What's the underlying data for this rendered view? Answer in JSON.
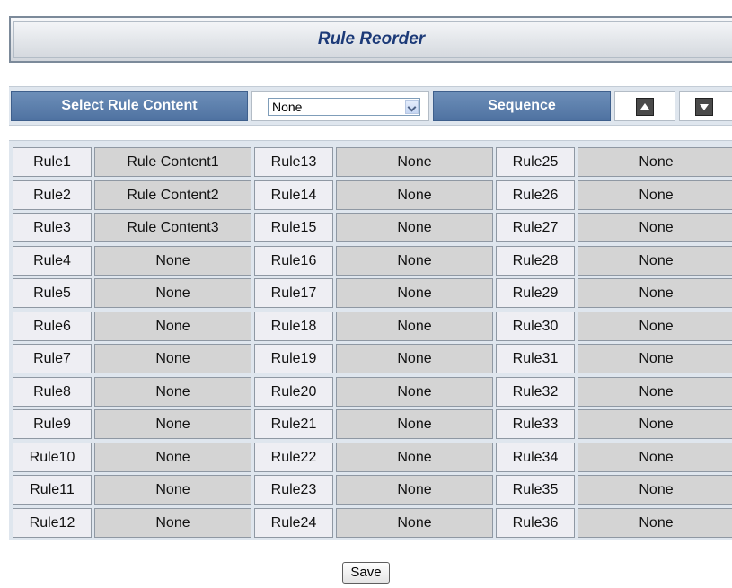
{
  "title": "Rule Reorder",
  "controls": {
    "select_label": "Select Rule Content",
    "selected_value": "None",
    "sequence_label": "Sequence",
    "up_icon": "arrow-up-icon",
    "down_icon": "arrow-down-icon"
  },
  "rules": {
    "columns": [
      [
        {
          "name": "Rule1",
          "content": "Rule Content1"
        },
        {
          "name": "Rule2",
          "content": "Rule Content2"
        },
        {
          "name": "Rule3",
          "content": "Rule Content3"
        },
        {
          "name": "Rule4",
          "content": "None"
        },
        {
          "name": "Rule5",
          "content": "None"
        },
        {
          "name": "Rule6",
          "content": "None"
        },
        {
          "name": "Rule7",
          "content": "None"
        },
        {
          "name": "Rule8",
          "content": "None"
        },
        {
          "name": "Rule9",
          "content": "None"
        },
        {
          "name": "Rule10",
          "content": "None"
        },
        {
          "name": "Rule11",
          "content": "None"
        },
        {
          "name": "Rule12",
          "content": "None"
        }
      ],
      [
        {
          "name": "Rule13",
          "content": "None"
        },
        {
          "name": "Rule14",
          "content": "None"
        },
        {
          "name": "Rule15",
          "content": "None"
        },
        {
          "name": "Rule16",
          "content": "None"
        },
        {
          "name": "Rule17",
          "content": "None"
        },
        {
          "name": "Rule18",
          "content": "None"
        },
        {
          "name": "Rule19",
          "content": "None"
        },
        {
          "name": "Rule20",
          "content": "None"
        },
        {
          "name": "Rule21",
          "content": "None"
        },
        {
          "name": "Rule22",
          "content": "None"
        },
        {
          "name": "Rule23",
          "content": "None"
        },
        {
          "name": "Rule24",
          "content": "None"
        }
      ],
      [
        {
          "name": "Rule25",
          "content": "None"
        },
        {
          "name": "Rule26",
          "content": "None"
        },
        {
          "name": "Rule27",
          "content": "None"
        },
        {
          "name": "Rule28",
          "content": "None"
        },
        {
          "name": "Rule29",
          "content": "None"
        },
        {
          "name": "Rule30",
          "content": "None"
        },
        {
          "name": "Rule31",
          "content": "None"
        },
        {
          "name": "Rule32",
          "content": "None"
        },
        {
          "name": "Rule33",
          "content": "None"
        },
        {
          "name": "Rule34",
          "content": "None"
        },
        {
          "name": "Rule35",
          "content": "None"
        },
        {
          "name": "Rule36",
          "content": "None"
        }
      ]
    ]
  },
  "footer": {
    "save_label": "Save"
  },
  "colors": {
    "title_text": "#1c3a78",
    "label_bg": "#5577a6",
    "panel_bg": "#dfe6ee",
    "rule_name_bg": "#eeeef3",
    "rule_content_bg": "#d4d4d4"
  }
}
